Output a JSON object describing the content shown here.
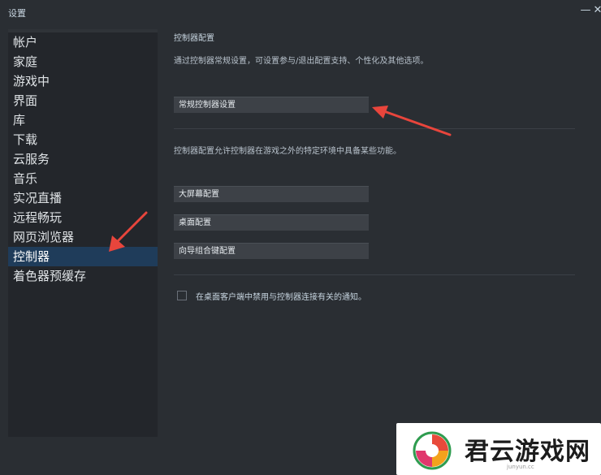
{
  "window": {
    "title": "设置",
    "minimize_glyph": "—",
    "close_glyph": "✕"
  },
  "sidebar": {
    "items": [
      {
        "label": "帐户"
      },
      {
        "label": "家庭"
      },
      {
        "label": "游戏中"
      },
      {
        "label": "界面"
      },
      {
        "label": "库"
      },
      {
        "label": "下载"
      },
      {
        "label": "云服务"
      },
      {
        "label": "音乐"
      },
      {
        "label": "实况直播"
      },
      {
        "label": "远程畅玩"
      },
      {
        "label": "网页浏览器"
      },
      {
        "label": "控制器",
        "active": true
      },
      {
        "label": "着色器预缓存"
      }
    ]
  },
  "main": {
    "heading": "控制器配置",
    "description": "通过控制器常规设置，可设置参与/退出配置支持、个性化及其他选项。",
    "general_settings_button": "常规控制器设置",
    "config_description": "控制器配置允许控制器在游戏之外的特定环境中具备某些功能。",
    "buttons": {
      "big_picture": "大屏幕配置",
      "desktop": "桌面配置",
      "guide_chord": "向导组合键配置"
    },
    "disable_notification_label": "在桌面客户端中禁用与控制器连接有关的通知。",
    "disable_notification_checked": false
  },
  "watermark": {
    "name": "君云游戏网",
    "sub": "junyun.cc"
  },
  "colors": {
    "background": "#2a2e33",
    "sidebar": "#23262b",
    "active": "#1f3c5a",
    "arrow": "#e8453c"
  }
}
